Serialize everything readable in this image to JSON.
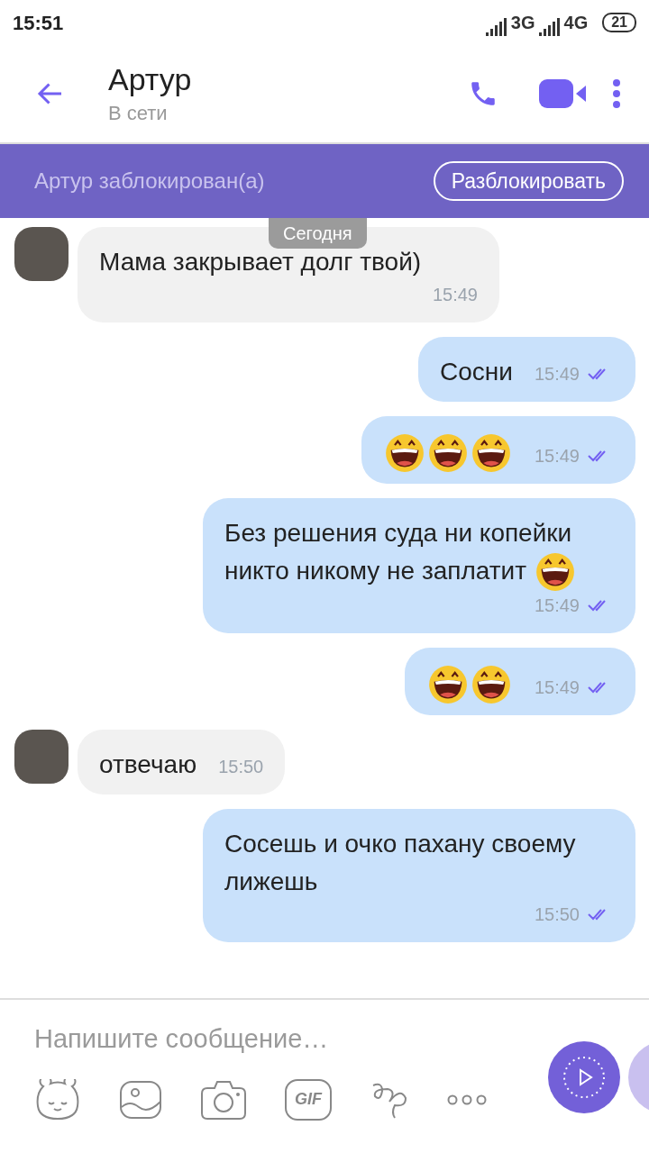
{
  "status_bar": {
    "time": "15:51",
    "networks": [
      "3G",
      "4G"
    ],
    "battery": "21"
  },
  "header": {
    "name": "Артур",
    "status": "В сети"
  },
  "blocked_banner": {
    "text": "Артур заблокирован(а)",
    "button": "Разблокировать"
  },
  "date_label": "Сегодня",
  "messages": [
    {
      "kind": "incoming",
      "parts": [
        {
          "kind": "text",
          "text": "Мама закрывает долг твой)"
        }
      ],
      "time": "15:49"
    },
    {
      "kind": "outgoing",
      "parts": [
        {
          "kind": "text",
          "text": "Сосни"
        }
      ],
      "time": "15:49",
      "read": true
    },
    {
      "kind": "outgoing",
      "parts": [
        {
          "kind": "emoji"
        },
        {
          "kind": "emoji"
        },
        {
          "kind": "emoji"
        }
      ],
      "time": "15:49",
      "read": true
    },
    {
      "kind": "outgoing",
      "parts": [
        {
          "kind": "text",
          "text": "Без решения суда ни копейки никто никому не заплатит"
        },
        {
          "kind": "emoji"
        }
      ],
      "time": "15:49",
      "read": true
    },
    {
      "kind": "outgoing",
      "parts": [
        {
          "kind": "emoji"
        },
        {
          "kind": "emoji"
        }
      ],
      "time": "15:49",
      "read": true
    },
    {
      "kind": "incoming",
      "parts": [
        {
          "kind": "text",
          "text": "отвечаю"
        }
      ],
      "time": "15:50"
    },
    {
      "kind": "outgoing",
      "parts": [
        {
          "kind": "text",
          "text": "Сосешь и очко пахану своему лижешь"
        }
      ],
      "time": "15:50",
      "read": true
    }
  ],
  "composer": {
    "placeholder": "Напишите сообщение…",
    "gif_label": "GIF"
  }
}
